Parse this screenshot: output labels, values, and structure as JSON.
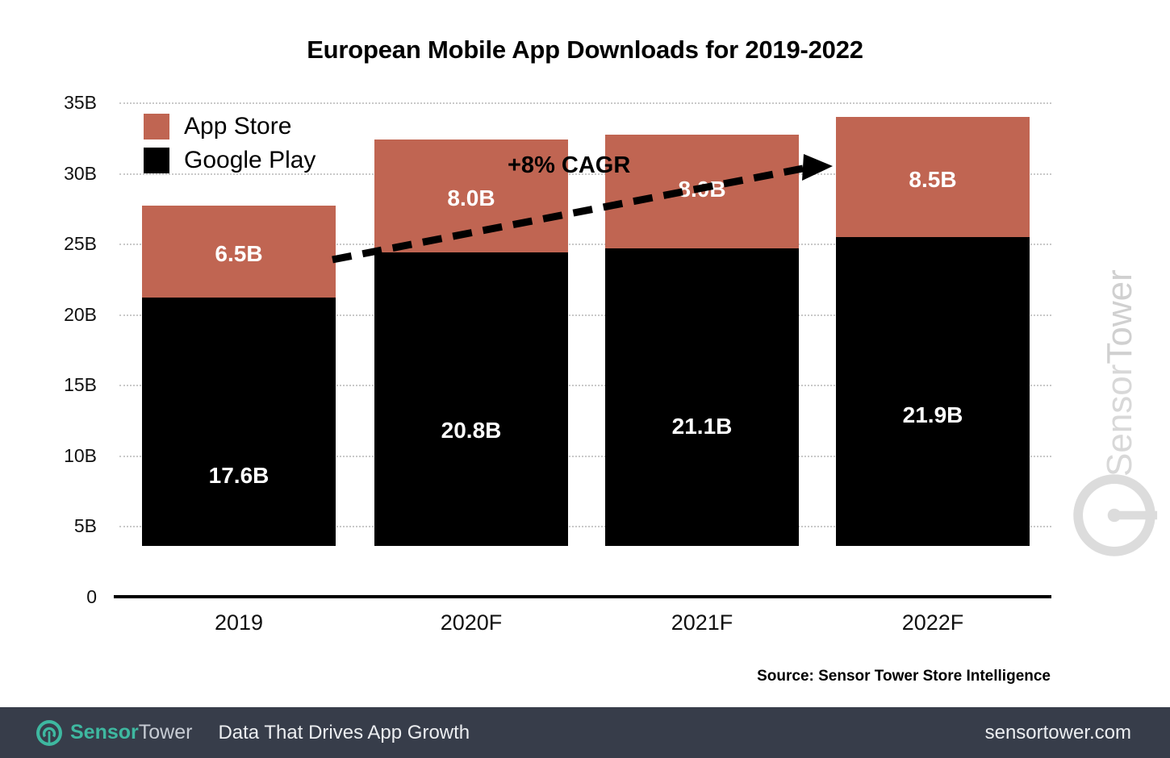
{
  "chart_data": {
    "type": "bar",
    "subtype": "stacked-bar",
    "title": "European Mobile App Downloads for 2019-2022",
    "categories": [
      "2019",
      "2020F",
      "2021F",
      "2022F"
    ],
    "series": [
      {
        "name": "Google Play",
        "color": "#000000",
        "values": [
          17.6,
          20.8,
          21.1,
          21.9
        ],
        "labels": [
          "17.6B",
          "20.8B",
          "21.1B",
          "21.9B"
        ]
      },
      {
        "name": "App Store",
        "color": "#c06552",
        "values": [
          6.5,
          8.0,
          8.0,
          8.5
        ],
        "labels": [
          "6.5B",
          "8.0B",
          "8.0B",
          "8.5B"
        ]
      }
    ],
    "totals": [
      24.1,
      28.8,
      29.1,
      30.4
    ],
    "xlabel": "",
    "ylabel": "",
    "ylim": [
      0,
      35
    ],
    "yticks": [
      0,
      5,
      10,
      15,
      20,
      25,
      30,
      35
    ],
    "ytick_labels": [
      "0",
      "5B",
      "10B",
      "15B",
      "20B",
      "25B",
      "30B",
      "35B"
    ],
    "grid": true,
    "grid_style": "dotted",
    "grid_color": "#c9c9c9",
    "legend_position": "top-left",
    "annotations": [
      {
        "text": "+8% CAGR",
        "type": "growth-arrow",
        "style": "dashed-arrow"
      }
    ],
    "source": "Source: Sensor Tower Store Intelligence"
  },
  "legend": {
    "items": [
      {
        "label": "App Store",
        "color": "#c06552"
      },
      {
        "label": "Google Play",
        "color": "#000000"
      }
    ]
  },
  "annotation": {
    "cagr_label": "+8% CAGR"
  },
  "watermark": {
    "brand_part1": "Sensor",
    "brand_part2": "Tower"
  },
  "footer": {
    "brand_part1": "Sensor",
    "brand_part2": "Tower",
    "tagline": "Data That Drives App Growth",
    "url": "sensortower.com",
    "background": "#373d4a",
    "accent": "#3eb8a0"
  }
}
